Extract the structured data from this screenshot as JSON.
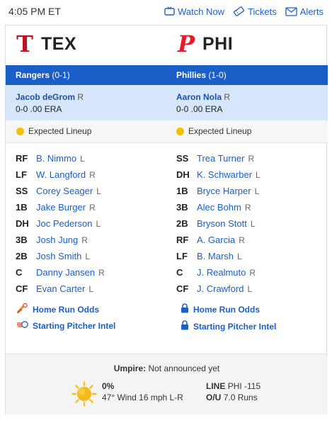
{
  "topbar": {
    "time": "4:05 PM ET",
    "watch_now": "Watch Now",
    "tickets": "Tickets",
    "alerts": "Alerts"
  },
  "away": {
    "abbr": "TEX",
    "logo_letter": "T",
    "logo_color": "#c0111f",
    "record_team": "Rangers",
    "record": "(0-1)",
    "pitcher": "Jacob deGrom",
    "pitcher_hand": "R",
    "pitcher_stats": "0-0 .00 ERA",
    "lineup_status": "Expected Lineup",
    "lineup": [
      {
        "pos": "RF",
        "name": "B. Nimmo",
        "hand": "L"
      },
      {
        "pos": "LF",
        "name": "W. Langford",
        "hand": "R"
      },
      {
        "pos": "SS",
        "name": "Corey Seager",
        "hand": "L"
      },
      {
        "pos": "1B",
        "name": "Jake Burger",
        "hand": "R"
      },
      {
        "pos": "DH",
        "name": "Joc Pederson",
        "hand": "L"
      },
      {
        "pos": "3B",
        "name": "Josh Jung",
        "hand": "R"
      },
      {
        "pos": "2B",
        "name": "Josh Smith",
        "hand": "L"
      },
      {
        "pos": "C",
        "name": "Danny Jansen",
        "hand": "R"
      },
      {
        "pos": "CF",
        "name": "Evan Carter",
        "hand": "L"
      }
    ],
    "hr_odds": "Home Run Odds",
    "pitcher_intel": "Starting Pitcher Intel"
  },
  "home": {
    "abbr": "PHI",
    "logo_letter": "P",
    "logo_color": "#e81828",
    "record_team": "Phillies",
    "record": "(1-0)",
    "pitcher": "Aaron Nola",
    "pitcher_hand": "R",
    "pitcher_stats": "0-0 .00 ERA",
    "lineup_status": "Expected Lineup",
    "lineup": [
      {
        "pos": "SS",
        "name": "Trea Turner",
        "hand": "R"
      },
      {
        "pos": "DH",
        "name": "K. Schwarber",
        "hand": "L"
      },
      {
        "pos": "1B",
        "name": "Bryce Harper",
        "hand": "L"
      },
      {
        "pos": "3B",
        "name": "Alec Bohm",
        "hand": "R"
      },
      {
        "pos": "2B",
        "name": "Bryson Stott",
        "hand": "L"
      },
      {
        "pos": "RF",
        "name": "A. Garcia",
        "hand": "R"
      },
      {
        "pos": "LF",
        "name": "B. Marsh",
        "hand": "L"
      },
      {
        "pos": "C",
        "name": "J. Realmuto",
        "hand": "R"
      },
      {
        "pos": "CF",
        "name": "J. Crawford",
        "hand": "L"
      }
    ],
    "hr_odds": "Home Run Odds",
    "pitcher_intel": "Starting Pitcher Intel"
  },
  "game": {
    "umpire_label": "Umpire:",
    "umpire_value": "Not announced yet",
    "precip": "0%",
    "weather": "47°  Wind 16 mph L-R",
    "line_label": "LINE",
    "line_value": "PHI -115",
    "ou_label": "O/U",
    "ou_value": "7.0 Runs"
  },
  "colors": {
    "accent": "#1a5fc8",
    "pitcher_bg": "#d7e6fa",
    "lineup_dot": "#f2c200"
  }
}
